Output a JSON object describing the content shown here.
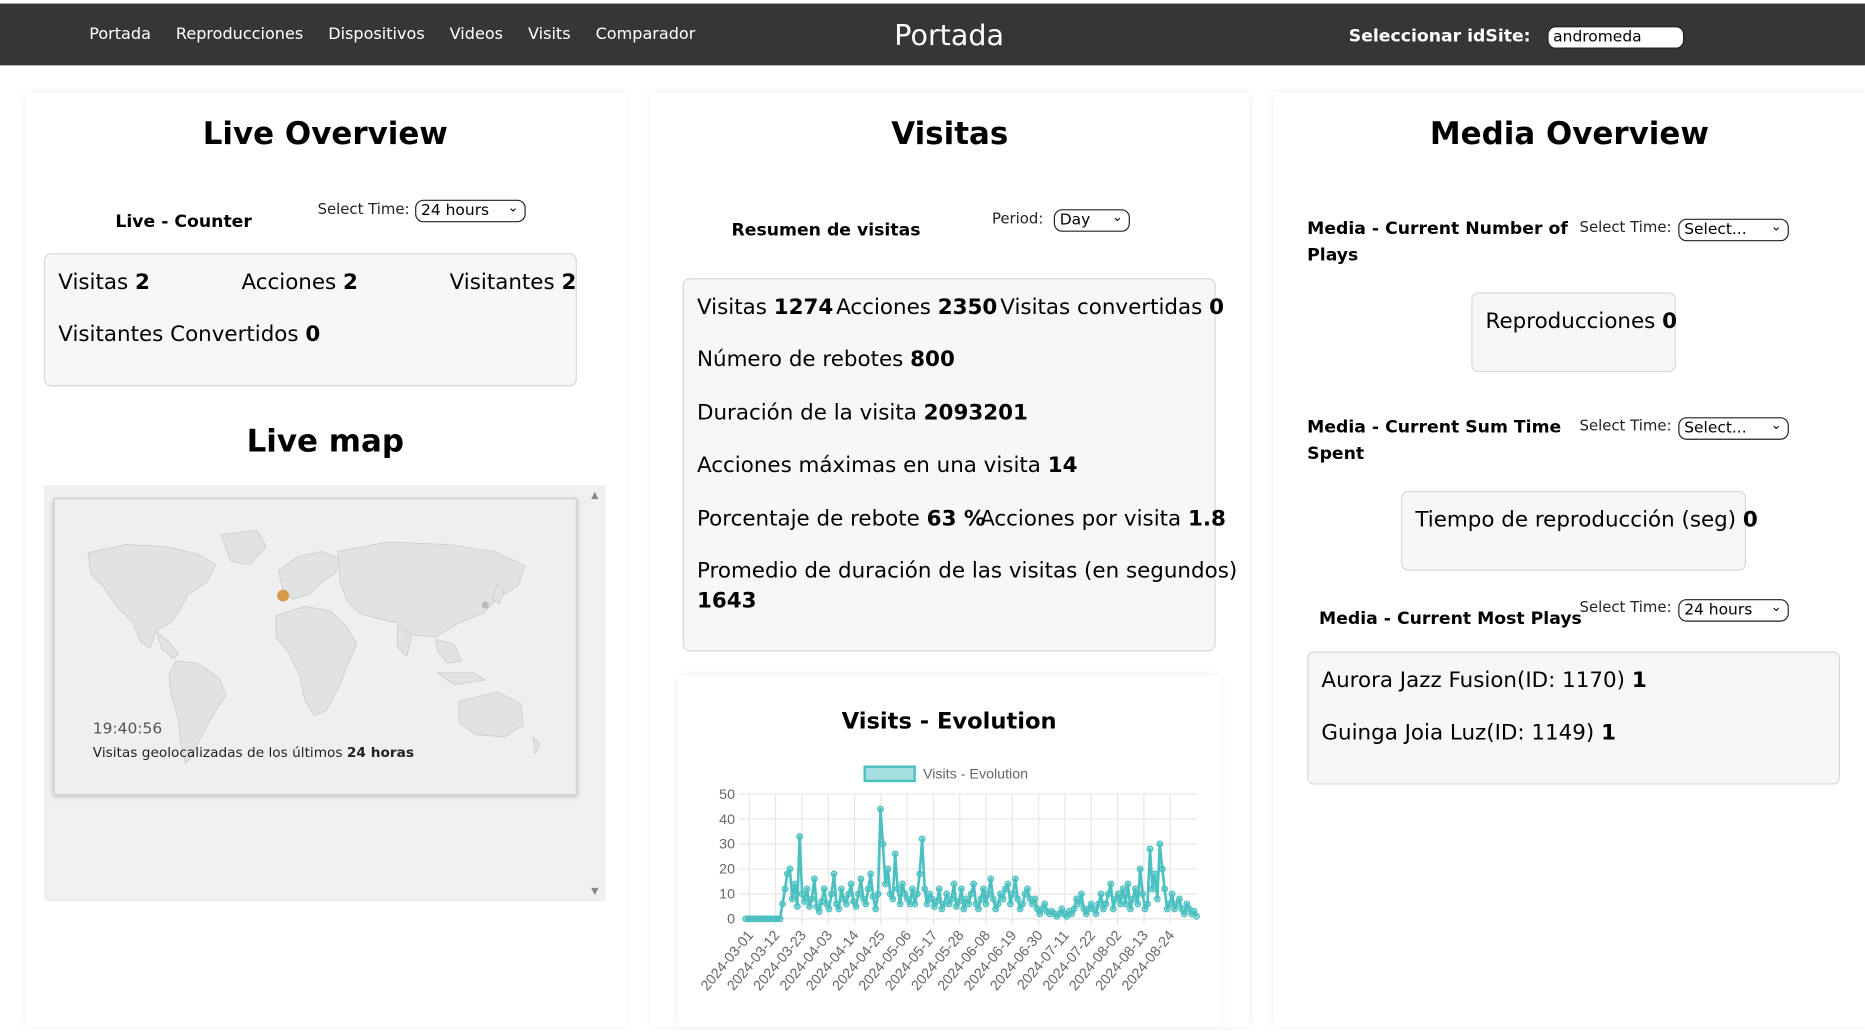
{
  "nav": {
    "links": [
      "Portada",
      "Reproducciones",
      "Dispositivos",
      "Videos",
      "Visits",
      "Comparador"
    ],
    "title": "Portada",
    "site_label": "Seleccionar idSite:",
    "site_value": "andromeda"
  },
  "live": {
    "title": "Live Overview",
    "counter_label": "Live - Counter",
    "time_label": "Select Time:",
    "time_value": "24 hours",
    "visitas_label": "Visitas",
    "visitas_value": "2",
    "acciones_label": "Acciones",
    "acciones_value": "2",
    "visitantes_label": "Visitantes",
    "visitantes_value": "2",
    "convertidos_label": "Visitantes Convertidos",
    "convertidos_value": "0",
    "map_title": "Live map",
    "map_time": "19:40:56",
    "map_caption": "Visitas geolocalizadas de los últimos",
    "map_caption_bold": "24 horas"
  },
  "visitas": {
    "title": "Visitas",
    "resumen_label": "Resumen de visitas",
    "period_label": "Period:",
    "period_value": "Day",
    "visitas_label": "Visitas",
    "visitas_value": "1274",
    "acciones_label": "Acciones",
    "acciones_value": "2350",
    "convertidas_label": "Visitas convertidas",
    "convertidas_value": "0",
    "rebotes_label": "Número de rebotes",
    "rebotes_value": "800",
    "duracion_label": "Duración de la visita",
    "duracion_value": "2093201",
    "max_label": "Acciones máximas en una visita",
    "max_value": "14",
    "porc_label": "Porcentaje de rebote",
    "porc_value": "63 %",
    "apv_label": "Acciones por visita",
    "apv_value": "1.8",
    "prom_label": "Promedio de duración de las visitas (en segundos)",
    "prom_value": "1643"
  },
  "media": {
    "title": "Media Overview",
    "plays_label_1": "Media - Current Number of",
    "plays_label_2": "Plays",
    "time_label": "Select Time:",
    "select_placeholder": "Select...",
    "repro_label": "Reproducciones",
    "repro_value": "0",
    "sum_label_1": "Media - Current Sum Time",
    "sum_label_2": "Spent",
    "tiempo_label": "Tiempo de reproducción (seg)",
    "tiempo_value": "0",
    "most_label": "Media - Current Most Plays",
    "most_time_value": "24 hours",
    "items": [
      {
        "name": "Aurora Jazz Fusion(ID: 1170)",
        "value": "1"
      },
      {
        "name": "Guinga Joia Luz(ID: 1149)",
        "value": "1"
      }
    ]
  },
  "colors": {
    "navbar": "#363636",
    "series": "#4bc0c0",
    "map_dot": "#d49a4a"
  },
  "chart_data": {
    "type": "line",
    "title": "Visits - Evolution",
    "series": [
      {
        "name": "Visits - Evolution",
        "values": [
          0,
          0,
          0,
          0,
          0,
          0,
          0,
          0,
          0,
          0,
          0,
          0,
          0,
          0,
          0,
          6,
          12,
          18,
          20,
          8,
          14,
          5,
          33,
          10,
          7,
          12,
          5,
          8,
          16,
          5,
          3,
          7,
          12,
          6,
          4,
          10,
          18,
          6,
          4,
          12,
          8,
          6,
          10,
          14,
          7,
          5,
          10,
          16,
          8,
          6,
          12,
          18,
          9,
          4,
          10,
          44,
          30,
          14,
          20,
          10,
          8,
          26,
          12,
          6,
          14,
          10,
          8,
          6,
          12,
          6,
          10,
          18,
          32,
          12,
          6,
          10,
          8,
          5,
          7,
          12,
          4,
          6,
          10,
          6,
          8,
          14,
          5,
          7,
          12,
          4,
          8,
          6,
          10,
          14,
          6,
          4,
          8,
          12,
          6,
          10,
          16,
          8,
          4,
          6,
          10,
          8,
          12,
          14,
          6,
          10,
          16,
          8,
          4,
          6,
          10,
          12,
          8,
          6,
          8,
          4,
          2,
          4,
          6,
          3,
          2,
          3,
          2,
          1,
          2,
          4,
          2,
          1,
          3,
          2,
          4,
          8,
          6,
          10,
          4,
          2,
          4,
          6,
          4,
          2,
          6,
          10,
          4,
          6,
          10,
          14,
          4,
          8,
          10,
          6,
          12,
          6,
          14,
          4,
          8,
          12,
          6,
          20,
          10,
          4,
          6,
          28,
          12,
          18,
          8,
          30,
          20,
          12,
          4,
          6,
          10,
          4,
          6,
          8,
          4,
          2,
          6,
          4,
          2,
          3,
          1
        ]
      }
    ],
    "x_ticks": [
      "2024-03-01",
      "2024-03-12",
      "2024-03-23",
      "2024-04-03",
      "2024-04-14",
      "2024-04-25",
      "2024-05-06",
      "2024-05-17",
      "2024-05-28",
      "2024-06-08",
      "2024-06-19",
      "2024-06-30",
      "2024-07-11",
      "2024-07-22",
      "2024-08-02",
      "2024-08-13",
      "2024-08-24"
    ],
    "y_ticks": [
      0,
      10,
      20,
      30,
      40,
      50
    ],
    "ylim": [
      0,
      50
    ],
    "grid": true,
    "legend": "top"
  }
}
